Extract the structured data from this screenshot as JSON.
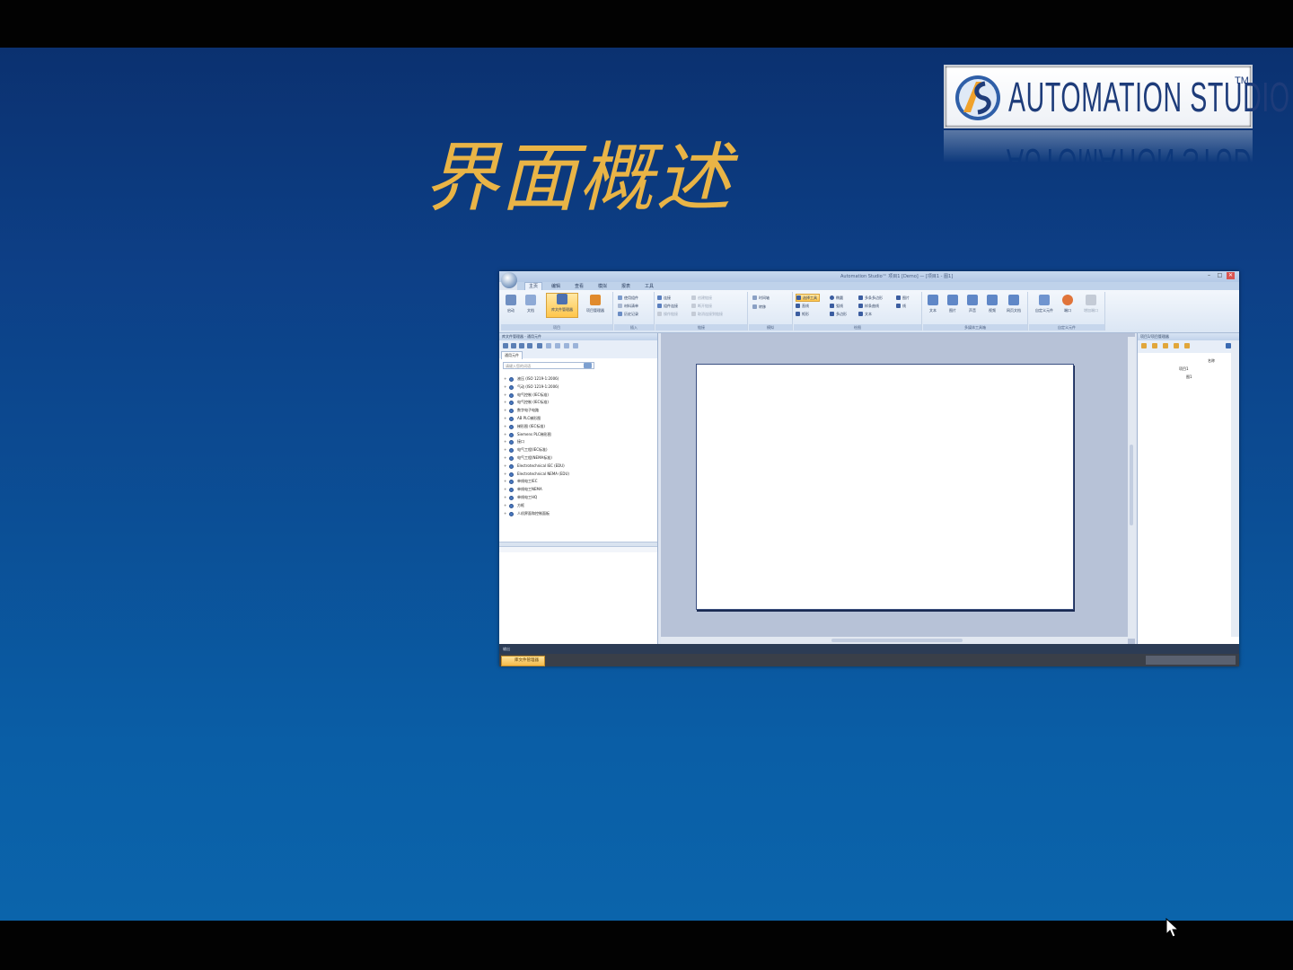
{
  "slide": {
    "title": "界面概述",
    "logo": {
      "text": "AUTOMATION STUDIO",
      "tm": "TM"
    }
  },
  "app": {
    "window_title": "Automation Studio™ 项目1 [Demo] — [项目1 - 图1]",
    "window_buttons": [
      "–",
      "□",
      "✕"
    ],
    "tabs": [
      "主页",
      "编辑",
      "查看",
      "模拟",
      "报表",
      "工具"
    ],
    "active_tab": 0,
    "ribbon": {
      "group_labels": [
        "项目",
        "插入",
        "链接",
        "模拟",
        "绘图",
        "多媒体工具箱",
        "自定义元件"
      ],
      "big_buttons": [
        "启动",
        "文档",
        "库文件管理器",
        "项目管理器"
      ],
      "insert_items": [
        "使用组件",
        "材料清单",
        "历史记录"
      ],
      "link_items": [
        "连接",
        "组件连接",
        "操作链接"
      ],
      "link_dim_items": [
        "创建链接",
        "断开链接",
        "取消连接到链接"
      ],
      "sim_items": [
        "时间轴",
        "转移"
      ],
      "draw_items": [
        "选择工具",
        "直线",
        "矩形",
        "椭圆",
        "弧线",
        "多边形",
        "多条多边形",
        "样条曲线",
        "文本",
        "图片",
        "线"
      ],
      "media_items": [
        "文本",
        "图片",
        "声音",
        "视频",
        "网页文档"
      ],
      "custom_items": [
        "自定义元件",
        "端口",
        "增加端口"
      ]
    },
    "library_panel": {
      "title": "库文件管理器 - 通用元件",
      "tab": "通用元件",
      "search_placeholder": "请键入您的词语",
      "items": [
        "液压 (ISO 1219-1:2006)",
        "气动 (ISO 1219-1:2006)",
        "电气控制 (IEC标准)",
        "电气控制 (IEC标准)",
        "数字电子电路",
        "AB PLC梯形图",
        "梯形图 (IEC标准)",
        "Siemens PLC梯形图",
        "接口",
        "电气工程(IEC标准)",
        "电气工程(NEMA标准)",
        "Electrotechnical IEC (EDU)",
        "Electrotechnical NEMA (EDU)",
        "单线电工IEC",
        "单线电工NEMA",
        "单线电工HQ",
        "方框",
        "人机界面和控制面板"
      ]
    },
    "project_panel": {
      "title": "项目1/项目管理器",
      "column": "名称",
      "rows": [
        "项目1",
        "图1"
      ]
    },
    "output": {
      "label": "输出"
    },
    "status_tab": "库文件管理器"
  },
  "colors": {
    "slide_top": "#0b3170",
    "slide_bottom": "#0b64ab",
    "title": "#e9b446",
    "logo_text": "#1e3c7a"
  }
}
